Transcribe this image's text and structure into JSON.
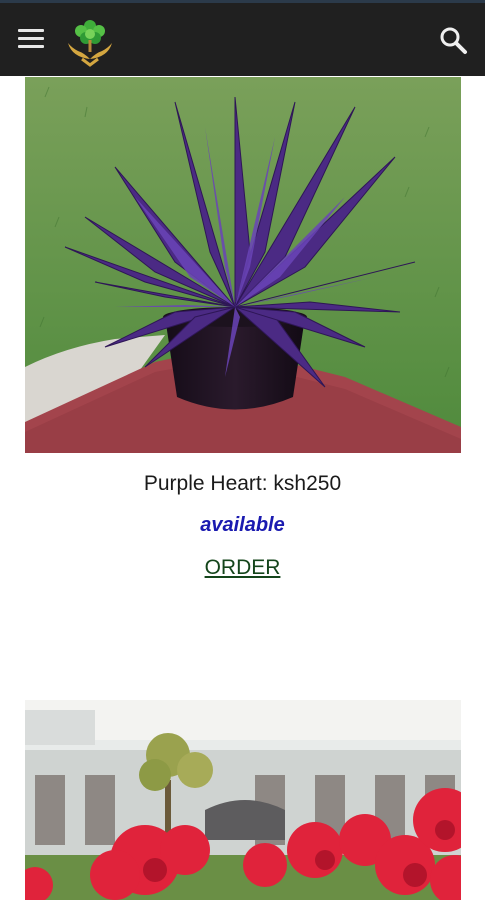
{
  "header": {
    "menu_icon": "hamburger-menu-icon",
    "logo_icon": "tree-in-hands-logo",
    "search_icon": "search-icon"
  },
  "products": [
    {
      "title": "Purple Heart: ksh250",
      "availability": "available",
      "order_label": "ORDER",
      "image": "purple-heart-plant-photo"
    },
    {
      "image": "red-canna-flowers-photo"
    }
  ],
  "colors": {
    "header_bg": "#202020",
    "availability": "#1a1ab0",
    "order_link": "#14451b"
  }
}
